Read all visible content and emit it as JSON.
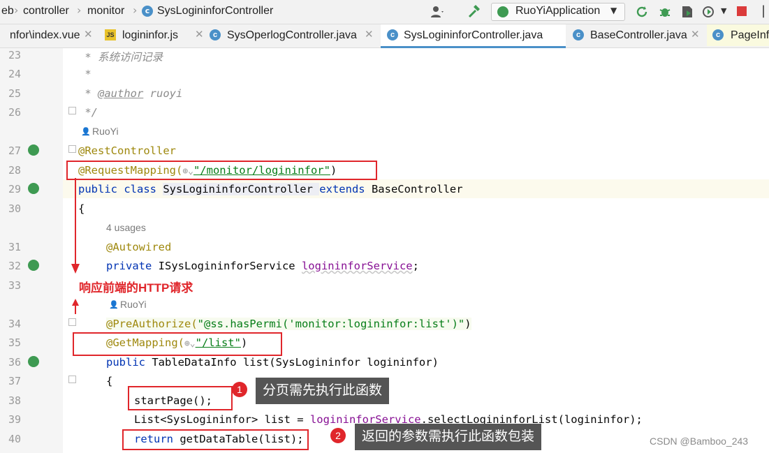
{
  "breadcrumb": [
    "eb",
    "controller",
    "monitor",
    "SysLogininforController"
  ],
  "run_config": "RuoYiApplication",
  "tabs": [
    {
      "label": "nfor\\index.vue",
      "icon": "vue-icon"
    },
    {
      "label": "logininfor.js",
      "icon": "js-file-icon"
    },
    {
      "label": "SysOperlogController.java",
      "icon": "class-icon"
    },
    {
      "label": "SysLogininforController.java",
      "icon": "class-icon",
      "active": true
    },
    {
      "label": "BaseController.java",
      "icon": "class-icon"
    },
    {
      "label": "PageInf",
      "icon": "class-icon"
    }
  ],
  "lines": {
    "l23": "23",
    "l24": "24",
    "l25": "25",
    "l26": "26",
    "l27": "27",
    "l28": "28",
    "l29": "29",
    "l30": "30",
    "l31": "31",
    "l32": "32",
    "l33": "33",
    "l34": "34",
    "l35": "35",
    "l36": "36",
    "l37": "37",
    "l38": "38",
    "l39": "39",
    "l40": "40"
  },
  "code": {
    "c23": " * 系统访问记录",
    "c24": " *",
    "c25_a": " * ",
    "c25_b": "@author",
    "c25_c": " ruoyi",
    "c26": " */",
    "author_hint1": "RuoYi",
    "c27": "@RestController",
    "c28_a": "@RequestMapping(",
    "c28_b": "\"/monitor/logininfor\"",
    "c28_c": ")",
    "c29_kw": "public class ",
    "c29_cls": "SysLogininforController ",
    "c29_kw2": "extends ",
    "c29_base": "BaseController",
    "c30": "{",
    "usages_hint": "4 usages",
    "c31": "@Autowired",
    "c32_kw": "private ",
    "c32_type": "ISysLogininforService ",
    "c32_field": "logininforService",
    "c32_end": ";",
    "author_hint2": "RuoYi",
    "c34_a": "@PreAuthorize(",
    "c34_b": "\"@ss.hasPermi('monitor:logininfor:list')\"",
    "c34_c": ")",
    "c35_a": "@GetMapping(",
    "c35_b": "\"/list\"",
    "c35_c": ")",
    "c36_kw": "public ",
    "c36_rest": "TableDataInfo list(SysLogininfor logininfor)",
    "c37": "{",
    "c38": "startPage();",
    "c39_a": "List<SysLogininfor> list = ",
    "c39_b": "logininforService",
    "c39_c": ".selectLogininforList(logininfor);",
    "c40_kw": "return ",
    "c40_rest": "getDataTable(list);"
  },
  "annotations": {
    "http_label": "响应前端的HTTP请求",
    "callout1_num": "1",
    "callout1_text": "分页需先执行此函数",
    "callout2_num": "2",
    "callout2_text": "返回的参数需执行此函数包装"
  },
  "watermark": "CSDN @Bamboo_243",
  "colors": {
    "annotation_red": "#e0262b",
    "callout_bg": "#555555",
    "active_tab_underline": "#4a90c8"
  }
}
